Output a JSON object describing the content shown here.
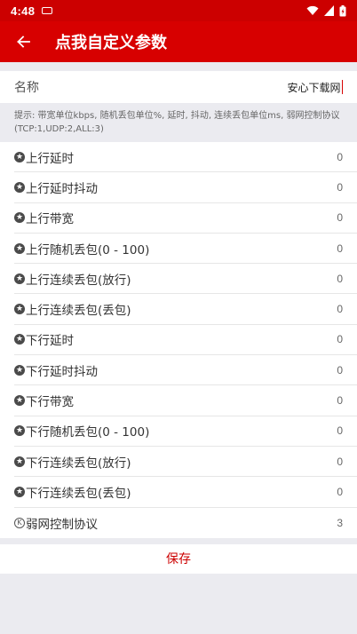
{
  "status": {
    "time": "4:48"
  },
  "app_bar": {
    "title": "点我自定义参数"
  },
  "name_field": {
    "label": "名称",
    "value": "安心下载网"
  },
  "hint": "提示: 带宽单位kbps, 随机丢包单位%, 延时, 抖动, 连续丢包单位ms, 弱网控制协议(TCP:1,UDP:2,ALL:3)",
  "params": [
    {
      "label": "上行延时",
      "value": "0",
      "icon": "star-icon"
    },
    {
      "label": "上行延时抖动",
      "value": "0",
      "icon": "star-icon"
    },
    {
      "label": "上行带宽",
      "value": "0",
      "icon": "star-icon"
    },
    {
      "label": "上行随机丢包(0 - 100)",
      "value": "0",
      "icon": "star-icon"
    },
    {
      "label": "上行连续丢包(放行)",
      "value": "0",
      "icon": "star-icon"
    },
    {
      "label": "上行连续丢包(丢包)",
      "value": "0",
      "icon": "star-icon"
    },
    {
      "label": "下行延时",
      "value": "0",
      "icon": "star-icon"
    },
    {
      "label": "下行延时抖动",
      "value": "0",
      "icon": "star-icon"
    },
    {
      "label": "下行带宽",
      "value": "0",
      "icon": "star-icon"
    },
    {
      "label": "下行随机丢包(0 - 100)",
      "value": "0",
      "icon": "star-icon"
    },
    {
      "label": "下行连续丢包(放行)",
      "value": "0",
      "icon": "star-icon"
    },
    {
      "label": "下行连续丢包(丢包)",
      "value": "0",
      "icon": "star-icon"
    },
    {
      "label": "弱网控制协议",
      "value": "3",
      "icon": "k-circle-icon"
    }
  ],
  "save_label": "保存",
  "colors": {
    "primary": "#d70000",
    "accent_text": "#cc0000",
    "background": "#ebebf0"
  }
}
